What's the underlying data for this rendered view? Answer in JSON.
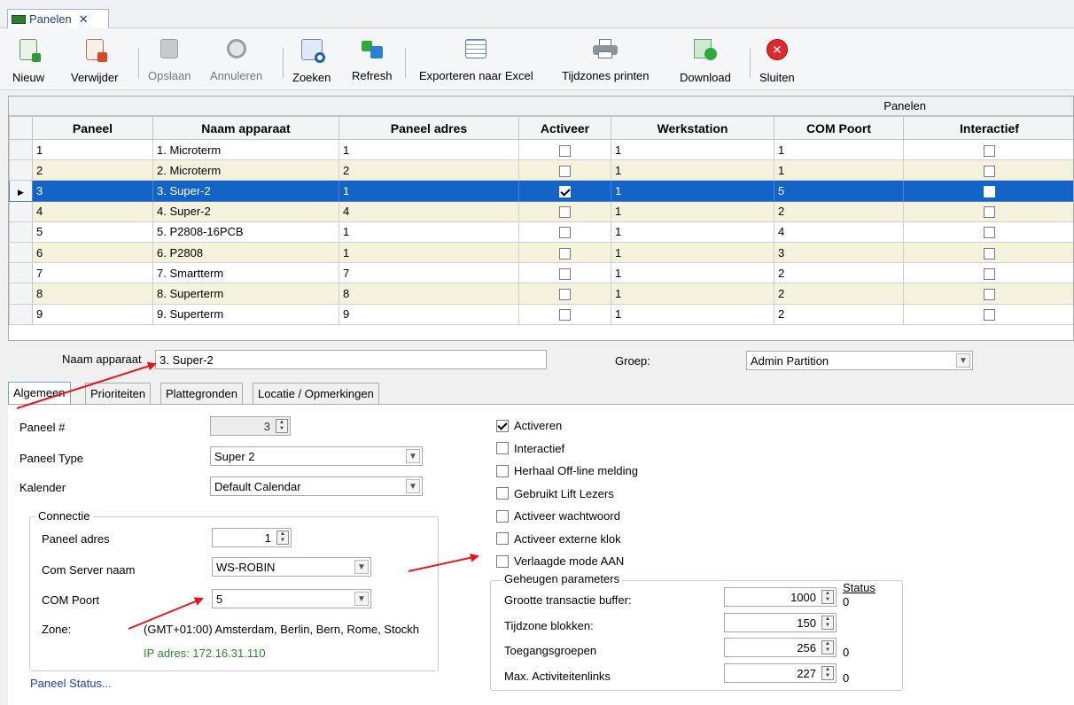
{
  "doc_tab": {
    "label": "Panelen",
    "close": "✕"
  },
  "toolbar": {
    "new": "Nieuw",
    "delete": "Verwijder",
    "save": "Opslaan",
    "cancel": "Annuleren",
    "search": "Zoeken",
    "refresh": "Refresh",
    "export": "Exporteren naar Excel",
    "print": "Tijdzones printen",
    "download": "Download",
    "close": "Sluiten"
  },
  "grid": {
    "caption": "Panelen",
    "columns": [
      "Paneel",
      "Naam apparaat",
      "Paneel adres",
      "Activeer",
      "Werkstation",
      "COM Poort",
      "Interactief"
    ],
    "rows": [
      {
        "paneel": "1",
        "naam": "1. Microterm",
        "adres": "1",
        "activeer": false,
        "werkstation": "1",
        "com": "1",
        "interactief": false
      },
      {
        "paneel": "2",
        "naam": "2. Microterm",
        "adres": "2",
        "activeer": false,
        "werkstation": "1",
        "com": "1",
        "interactief": false
      },
      {
        "paneel": "3",
        "naam": "3. Super-2",
        "adres": "1",
        "activeer": true,
        "werkstation": "1",
        "com": "5",
        "interactief": false
      },
      {
        "paneel": "4",
        "naam": "4. Super-2",
        "adres": "4",
        "activeer": false,
        "werkstation": "1",
        "com": "2",
        "interactief": false
      },
      {
        "paneel": "5",
        "naam": "5. P2808-16PCB",
        "adres": "1",
        "activeer": false,
        "werkstation": "1",
        "com": "4",
        "interactief": false
      },
      {
        "paneel": "6",
        "naam": "6. P2808",
        "adres": "1",
        "activeer": false,
        "werkstation": "1",
        "com": "3",
        "interactief": false
      },
      {
        "paneel": "7",
        "naam": "7. Smartterm",
        "adres": "7",
        "activeer": false,
        "werkstation": "1",
        "com": "2",
        "interactief": false
      },
      {
        "paneel": "8",
        "naam": "8. Superterm",
        "adres": "8",
        "activeer": false,
        "werkstation": "1",
        "com": "2",
        "interactief": false
      },
      {
        "paneel": "9",
        "naam": "9. Superterm",
        "adres": "9",
        "activeer": false,
        "werkstation": "1",
        "com": "2",
        "interactief": false
      }
    ],
    "selected_row": 2
  },
  "form": {
    "naam_label": "Naam apparaat",
    "naam_value": "3. Super-2",
    "groep_label": "Groep:",
    "groep_value": "Admin Partition"
  },
  "tabs": [
    "Algemeen",
    "Prioriteiten",
    "Plattegronden",
    "Locatie / Opmerkingen"
  ],
  "algemeen": {
    "paneel_label": "Paneel #",
    "paneel_value": "3",
    "type_label": "Paneel Type",
    "type_value": "Super 2",
    "kalender_label": "Kalender",
    "kalender_value": "Default Calendar",
    "connectie_title": "Connectie",
    "adres_label": "Paneel adres",
    "adres_value": "1",
    "server_label": "Com Server naam",
    "server_value": "WS-ROBIN",
    "com_label": "COM Poort",
    "com_value": "5",
    "zone_label": "Zone:",
    "zone_value": "(GMT+01:00) Amsterdam, Berlin, Bern, Rome, Stockh",
    "ip_text": "IP adres: 172.16.31.110",
    "status_link": "Paneel Status..."
  },
  "options": [
    {
      "label": "Activeren",
      "checked": true
    },
    {
      "label": "Interactief",
      "checked": false
    },
    {
      "label": "Herhaal Off-line melding",
      "checked": false
    },
    {
      "label": "Gebruikt Lift Lezers",
      "checked": false
    },
    {
      "label": "Activeer wachtwoord",
      "checked": false
    },
    {
      "label": "Activeer externe klok",
      "checked": false
    },
    {
      "label": "Verlaagde mode AAN",
      "checked": false
    }
  ],
  "memory": {
    "title": "Geheugen parameters",
    "status_header": "Status",
    "rows": [
      {
        "label": "Grootte transactie buffer:",
        "value": "1000",
        "status": "0"
      },
      {
        "label": "Tijdzone blokken:",
        "value": "150",
        "status": ""
      },
      {
        "label": "Toegangsgroepen",
        "value": "256",
        "status": "0"
      },
      {
        "label": "Max. Activiteitenlinks",
        "value": "227",
        "status": "0"
      }
    ]
  },
  "colors": {
    "selection": "#1464c8",
    "alt_row": "#f4f2dc",
    "arrow": "#e8141c",
    "link": "#1a3fc4",
    "ip_green": "#2a8a2a"
  }
}
